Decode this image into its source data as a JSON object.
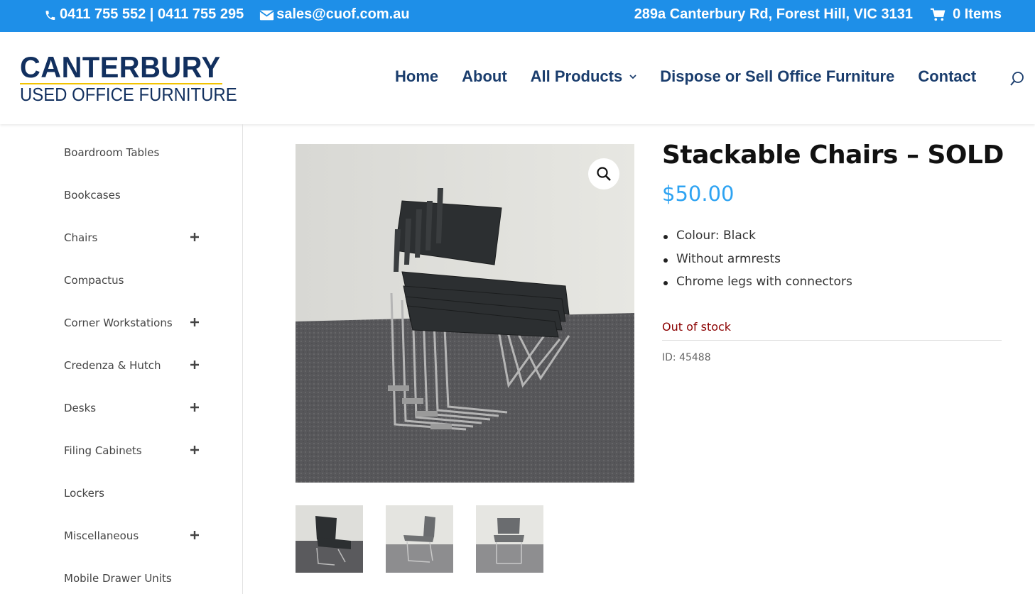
{
  "topbar": {
    "phone": "0411 755 552 | 0411 755 295",
    "email": "sales@cuof.com.au",
    "address": "289a Canterbury Rd, Forest Hill, VIC 3131",
    "cart": "0 Items",
    "bg_color": "#1e8fe8"
  },
  "logo": {
    "line1": "CANTERBURY",
    "line2": "USED OFFICE FURNITURE"
  },
  "nav": {
    "items": [
      "Home",
      "About",
      "All Products",
      "Dispose or Sell Office Furniture",
      "Contact"
    ]
  },
  "sidebar": {
    "items": [
      {
        "label": "Boardroom Tables",
        "expandable": false
      },
      {
        "label": "Bookcases",
        "expandable": false
      },
      {
        "label": "Chairs",
        "expandable": true
      },
      {
        "label": "Compactus",
        "expandable": false
      },
      {
        "label": "Corner Workstations",
        "expandable": true
      },
      {
        "label": "Credenza & Hutch",
        "expandable": true
      },
      {
        "label": "Desks",
        "expandable": true
      },
      {
        "label": "Filing Cabinets",
        "expandable": true
      },
      {
        "label": "Lockers",
        "expandable": false
      },
      {
        "label": "Miscellaneous",
        "expandable": true
      },
      {
        "label": "Mobile Drawer Units",
        "expandable": false
      }
    ]
  },
  "product": {
    "title": "Stackable Chairs – SOLD",
    "price": "$50.00",
    "features": [
      "Colour: Black",
      "Without armrests",
      "Chrome legs with connectors"
    ],
    "stock": "Out of stock",
    "sku": "ID: 45488",
    "price_color": "#2ea3f2",
    "stock_color": "#8b0000"
  },
  "gallery": {
    "main_image": "stacked-black-chairs",
    "thumbnails": [
      "stacked-black-chairs",
      "grey-chair-side",
      "grey-chair-front"
    ]
  },
  "icons": {
    "phone": "phone-icon",
    "email": "envelope-icon",
    "cart": "cart-icon",
    "search": "search-icon",
    "zoom": "magnifier-icon",
    "expand": "plus-icon"
  }
}
